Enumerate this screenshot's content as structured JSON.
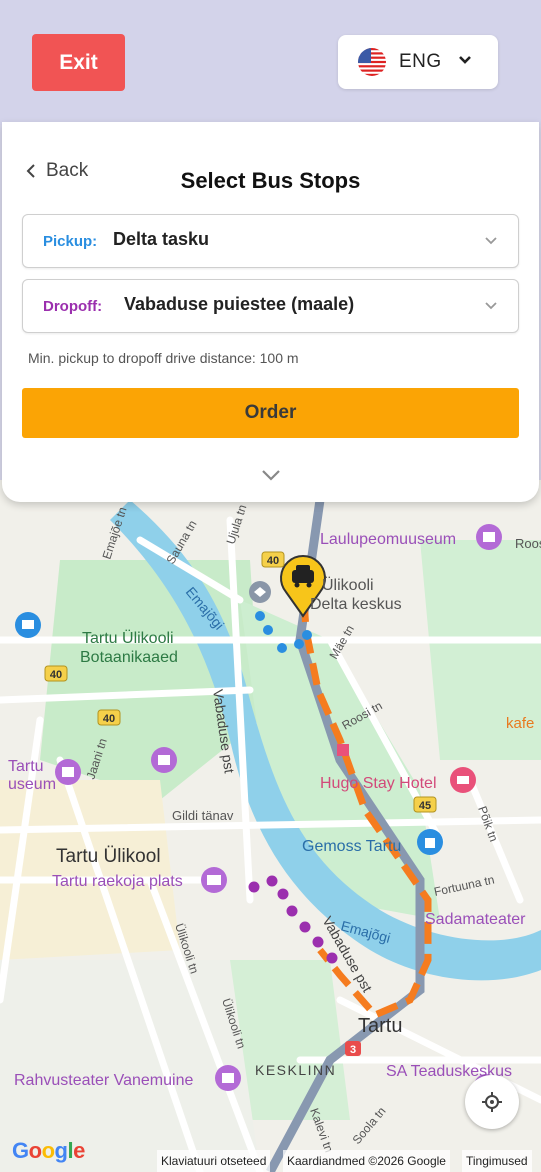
{
  "header": {
    "exit_label": "Exit",
    "language": {
      "code": "ENG",
      "flag_icon": "us-flag-icon"
    }
  },
  "panel": {
    "back_label": "Back",
    "title": "Select Bus Stops",
    "pickup": {
      "label": "Pickup:",
      "value": "Delta tasku",
      "color": "#2a8ee0"
    },
    "dropoff": {
      "label": "Dropoff:",
      "value": "Vabaduse puiestee (maale)",
      "color": "#9b2fae"
    },
    "hint": "Min. pickup to dropoff drive distance: 100 m",
    "order_label": "Order"
  },
  "map": {
    "labels": {
      "laulupeomuuseum": "Laulupeomuuseum",
      "ylikooli": "Ülikooli",
      "delta_keskus": "Delta keskus",
      "tartu_ylikooli": "Tartu Ülikooli",
      "botaanikaaed": "Botaanikaaed",
      "emajogi_top": "Emajõgi",
      "emajogi_bottom": "Emajõgi",
      "vabaduse_pst": "Vabaduse pst",
      "vabaduse_pst_2": "Vabaduse pst",
      "tartu_museum_1": "Tartu",
      "tartu_museum_2": "useum",
      "hugo_stay": "Hugo Stay Hotel",
      "gemoss": "Gemoss Tartu",
      "tartu_ylikool": "Tartu Ülikool",
      "raekoja_plats": "Tartu raekoja plats",
      "sadamateater": "Sadamateater",
      "tartu_center": "Tartu",
      "kesklinn": "KESKLINN",
      "vanemuine": "Rahvusteater Vanemuine",
      "sa_teaduskeskus": "SA Teaduskeskus",
      "gildi": "Gildi tänav",
      "jaani": "Jaani tn",
      "ylikooli_tn": "Ülikooli tn",
      "ylikooli_tn_2": "Ülikooli tn",
      "mae": "Mäe tn",
      "roosi": "Roosi tn",
      "fortuuna": "Fortuuna tn",
      "polgu": "Põik tn",
      "kalevi": "Kalevi tn",
      "soola": "Soola tn",
      "emajoe": "Emajõe tn",
      "sauna": "Sauna tn",
      "ujula": "Ujula tn",
      "kafe": "kafe",
      "roosi_right": "Roosi",
      "shield_40a": "40",
      "shield_40b": "40",
      "shield_40c": "40",
      "shield_45": "45",
      "shield_3": "3"
    },
    "route_color": "#f57c1f",
    "pickup_dots_color": "#2a8ee0",
    "dropoff_dots_color": "#9b2fae"
  },
  "attribution": {
    "google": "Google",
    "shortcuts": "Klaviatuuri otseteed",
    "map_data": "Kaardiandmed ©2026 Google",
    "terms": "Tingimused"
  }
}
